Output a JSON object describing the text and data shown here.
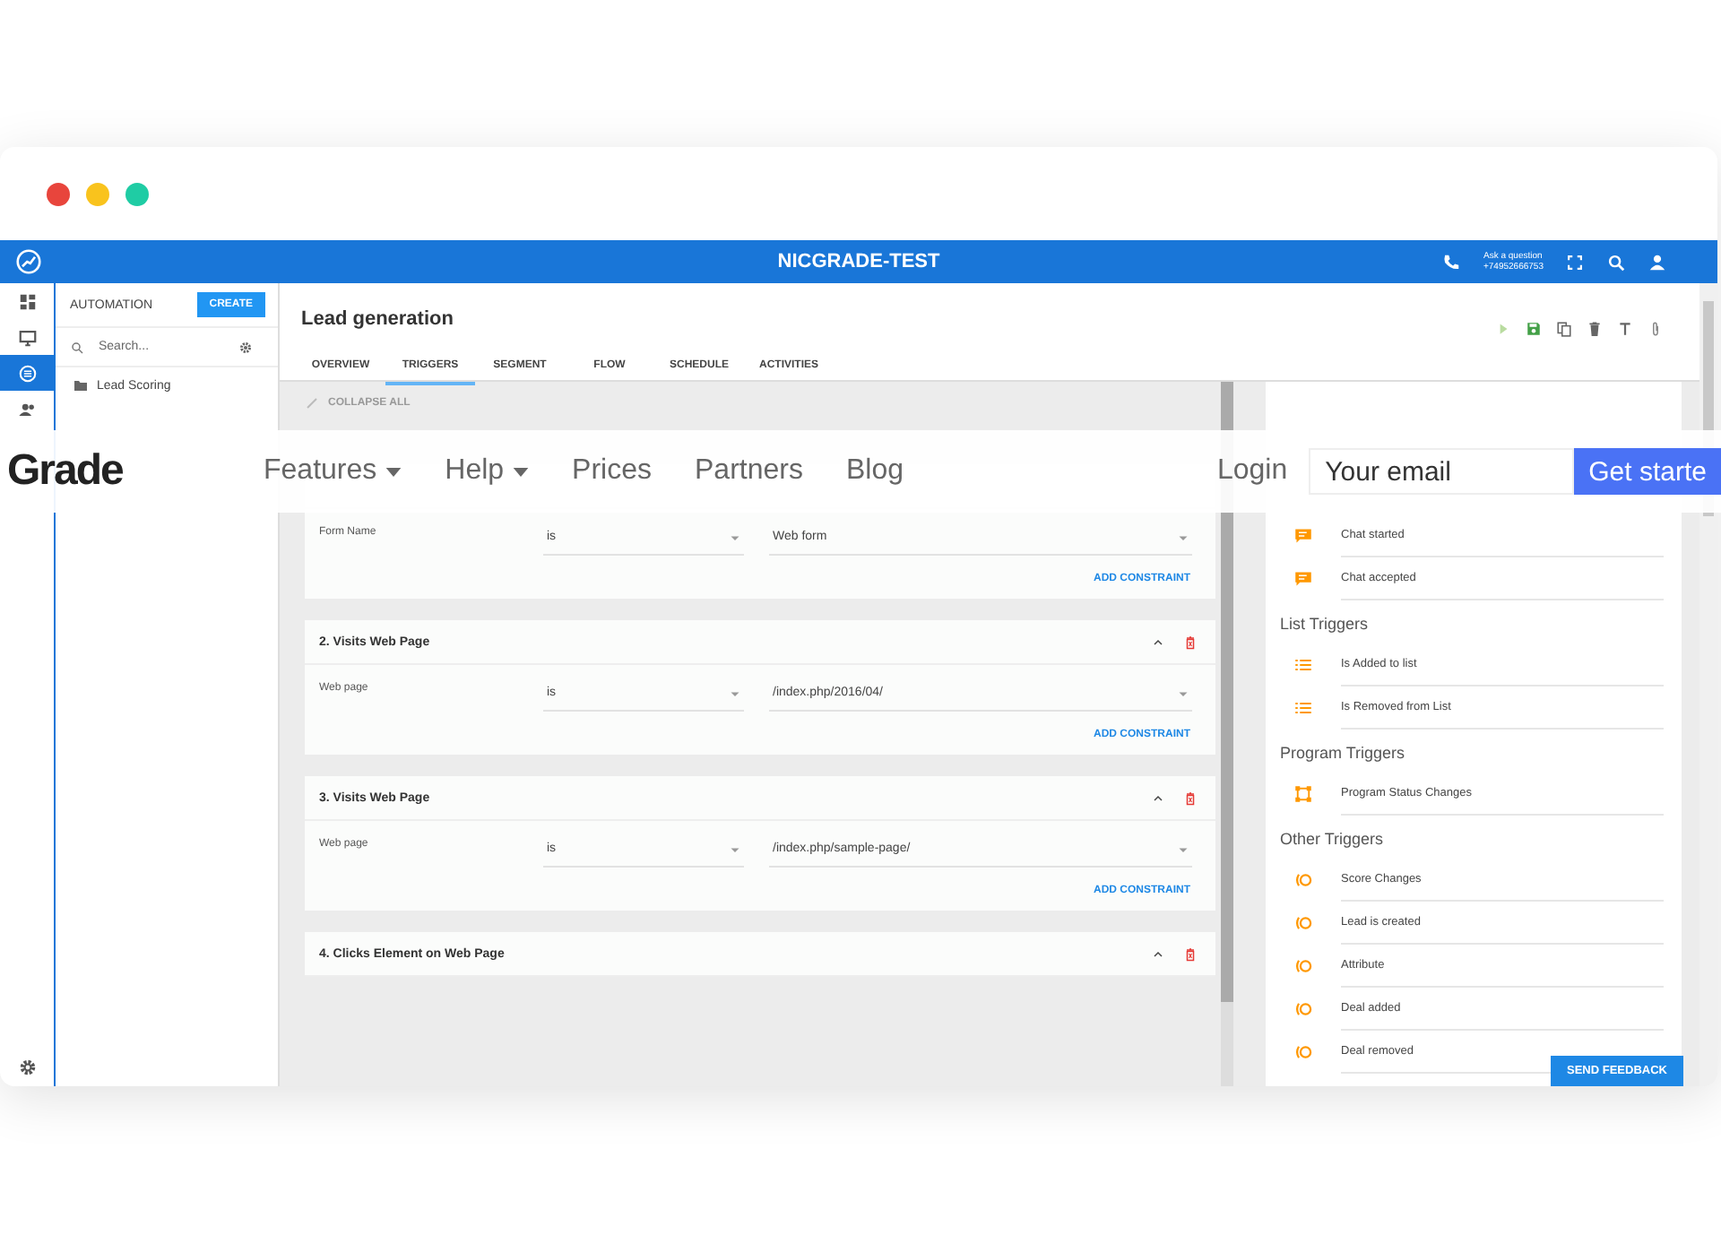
{
  "app_bar": {
    "title": "NICGRADE-TEST",
    "contact_label": "Ask a question",
    "phone": "+74952666753"
  },
  "rail": [
    {
      "kind": "dashboard",
      "selected": false
    },
    {
      "kind": "monitor",
      "selected": false
    },
    {
      "kind": "automation",
      "selected": true
    },
    {
      "kind": "people",
      "selected": false
    }
  ],
  "sidebar": {
    "title": "AUTOMATION",
    "create_button": "CREATE",
    "search_placeholder": "Search...",
    "items": [
      {
        "label": "Lead Scoring"
      }
    ]
  },
  "main": {
    "title": "Lead generation",
    "tabs": [
      {
        "label": "OVERVIEW",
        "selected": false
      },
      {
        "label": "TRIGGERS",
        "selected": true
      },
      {
        "label": "SEGMENT",
        "selected": false
      },
      {
        "label": "FLOW",
        "selected": false
      },
      {
        "label": "SCHEDULE",
        "selected": false
      },
      {
        "label": "ACTIVITIES",
        "selected": false
      }
    ],
    "collapse_all": "COLLAPSE ALL"
  },
  "triggers": [
    {
      "constraint": {
        "field": "Form Name",
        "operator": "is",
        "value": "Web form"
      },
      "add_constraint": "ADD CONSTRAINT"
    },
    {
      "title": "2. Visits Web Page",
      "constraint": {
        "field": "Web page",
        "operator": "is",
        "value": "/index.php/2016/04/"
      },
      "add_constraint": "ADD CONSTRAINT"
    },
    {
      "title": "3. Visits Web Page",
      "constraint": {
        "field": "Web page",
        "operator": "is",
        "value": "/index.php/sample-page/"
      },
      "add_constraint": "ADD CONSTRAINT"
    },
    {
      "title": "4. Clicks Element on Web Page"
    }
  ],
  "trigger_groups": [
    {
      "items": [
        {
          "kind": "chat",
          "label": "Chat started"
        },
        {
          "kind": "chat",
          "label": "Chat accepted"
        }
      ]
    },
    {
      "heading": "List Triggers",
      "items": [
        {
          "kind": "list",
          "label": "Is Added to list"
        },
        {
          "kind": "list",
          "label": "Is Removed from List"
        }
      ]
    },
    {
      "heading": "Program Triggers",
      "items": [
        {
          "kind": "program",
          "label": "Program Status Changes"
        }
      ]
    },
    {
      "heading": "Other Triggers",
      "items": [
        {
          "kind": "other",
          "label": "Score Changes"
        },
        {
          "kind": "other",
          "label": "Lead is created"
        },
        {
          "kind": "other",
          "label": "Attribute"
        },
        {
          "kind": "other",
          "label": "Deal added"
        },
        {
          "kind": "other",
          "label": "Deal removed"
        }
      ]
    }
  ],
  "send_feedback": "SEND FEEDBACK",
  "site_nav": {
    "brand": "Grade",
    "links": [
      {
        "label": "Features",
        "dropdown": true
      },
      {
        "label": "Help",
        "dropdown": true
      },
      {
        "label": "Prices",
        "dropdown": false
      },
      {
        "label": "Partners",
        "dropdown": false
      },
      {
        "label": "Blog",
        "dropdown": false
      }
    ],
    "login": "Login",
    "email_placeholder": "Your email",
    "cta": "Get starte"
  }
}
